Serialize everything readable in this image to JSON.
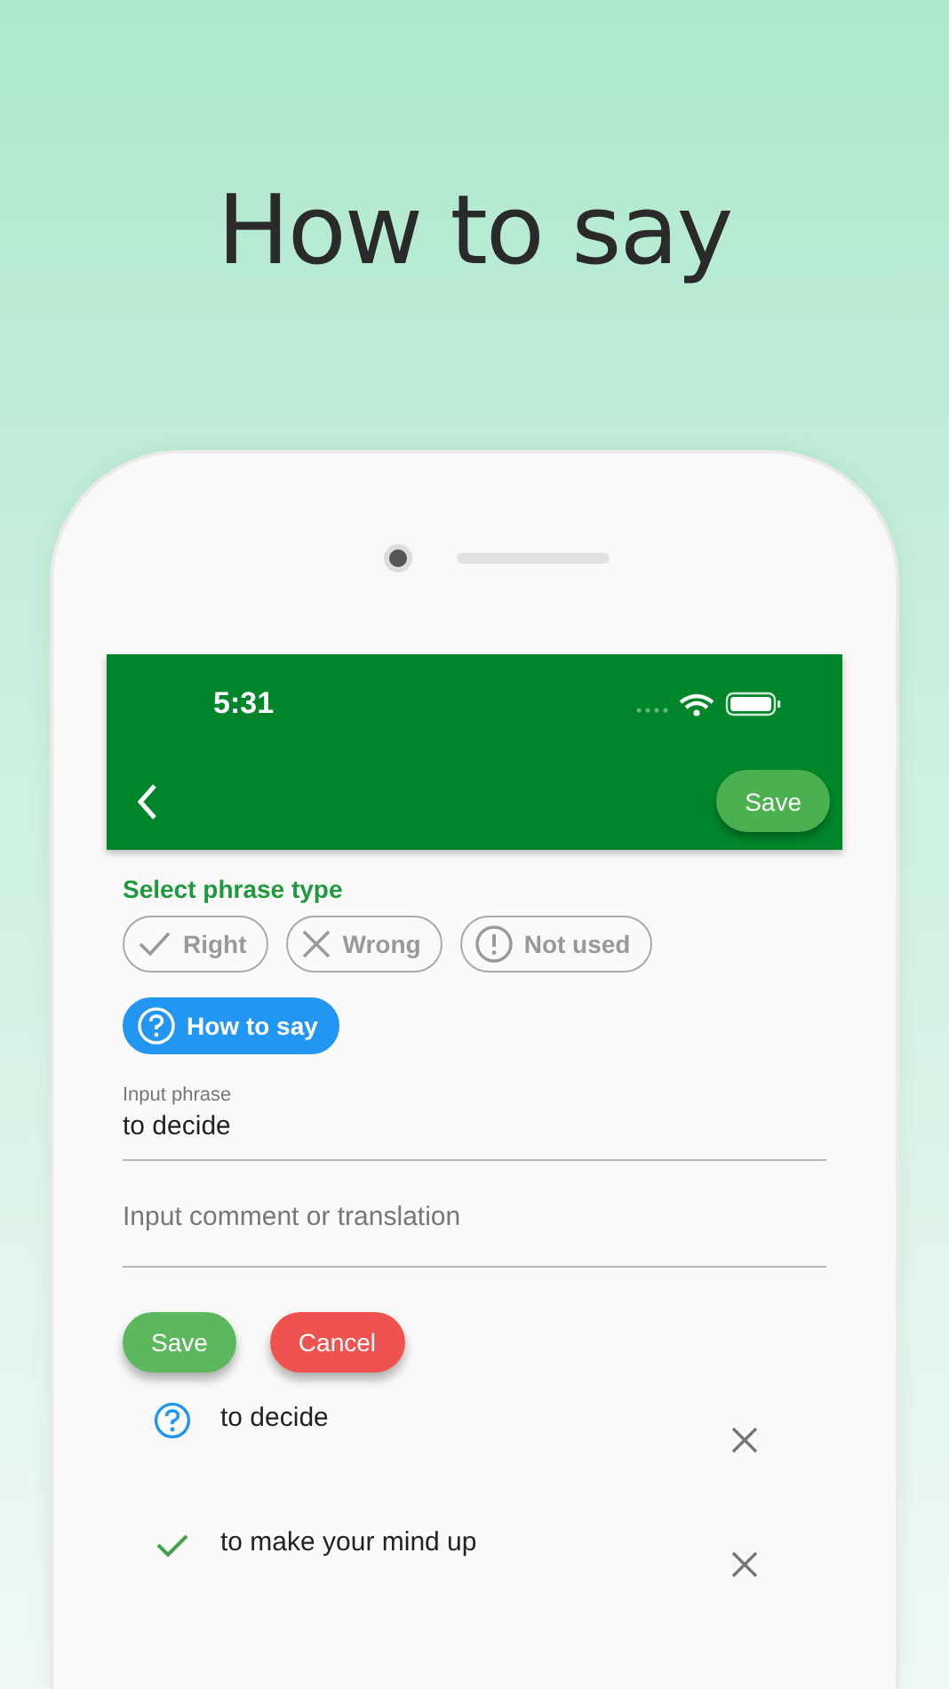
{
  "headline": "How to say",
  "status_bar": {
    "time": "5:31"
  },
  "app_bar": {
    "save_label": "Save"
  },
  "phrase_type": {
    "title": "Select phrase type",
    "chips": [
      {
        "kind": "right",
        "label": "Right",
        "selected": false
      },
      {
        "kind": "wrong",
        "label": "Wrong",
        "selected": false
      },
      {
        "kind": "not_used",
        "label": "Not used",
        "selected": false
      },
      {
        "kind": "how_to_say",
        "label": "How to say",
        "selected": true
      }
    ]
  },
  "phrase_field": {
    "label": "Input phrase",
    "value": "to decide"
  },
  "comment_field": {
    "placeholder": "Input comment or translation"
  },
  "buttons": {
    "save": "Save",
    "cancel": "Cancel"
  },
  "entries": [
    {
      "kind": "how_to_say",
      "text": "to decide"
    },
    {
      "kind": "right",
      "text": "to make your mind up"
    }
  ]
}
